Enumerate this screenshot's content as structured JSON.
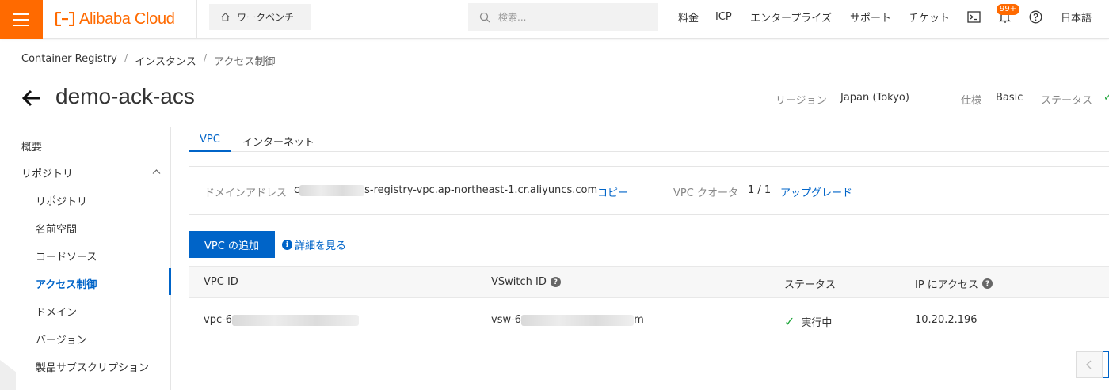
{
  "topbar": {
    "brand": "Alibaba Cloud",
    "workbench": "ワークベンチ",
    "search_placeholder": "検索...",
    "nav": [
      "料金",
      "ICP",
      "エンタープライズ",
      "サポート",
      "チケット"
    ],
    "badge": "99+",
    "language": "日本語",
    "accent_color": "#ff6a00"
  },
  "breadcrumb": [
    "Container Registry",
    "インスタンス",
    "アクセス制御"
  ],
  "header": {
    "title": "demo-ack-acs",
    "region_label": "リージョン",
    "region_value": "Japan (Tokyo)",
    "spec_label": "仕様",
    "spec_value": "Basic",
    "status_label": "ステータス"
  },
  "sidebar": {
    "overview": "概要",
    "repo_group": "リポジトリ",
    "items": [
      "リポジトリ",
      "名前空間",
      "コードソース",
      "アクセス制御",
      "ドメイン",
      "バージョン",
      "製品サブスクリプション"
    ],
    "active": "アクセス制御"
  },
  "tabs": [
    "VPC",
    "インターネット"
  ],
  "info": {
    "domain_label": "ドメインアドレス",
    "domain_prefix": "c",
    "domain_suffix": "s-registry-vpc.ap-northeast-1.cr.aliyuncs.com",
    "copy": "コピー",
    "quota_label": "VPC クオータ",
    "quota_value": "1 / 1",
    "upgrade": "アップグレード"
  },
  "actions": {
    "add_vpc": "VPC の追加",
    "details": "詳細を見る"
  },
  "table": {
    "columns": [
      "VPC ID",
      "VSwitch ID",
      "ステータス",
      "IP にアクセス"
    ],
    "rows": [
      {
        "vpc_prefix": "vpc-6",
        "vsw_prefix": "vsw-6",
        "vsw_suffix": "m",
        "status": "実行中",
        "ip": "10.20.2.196"
      }
    ]
  },
  "colors": {
    "primary": "#0064c8",
    "success": "#1ea53a"
  }
}
